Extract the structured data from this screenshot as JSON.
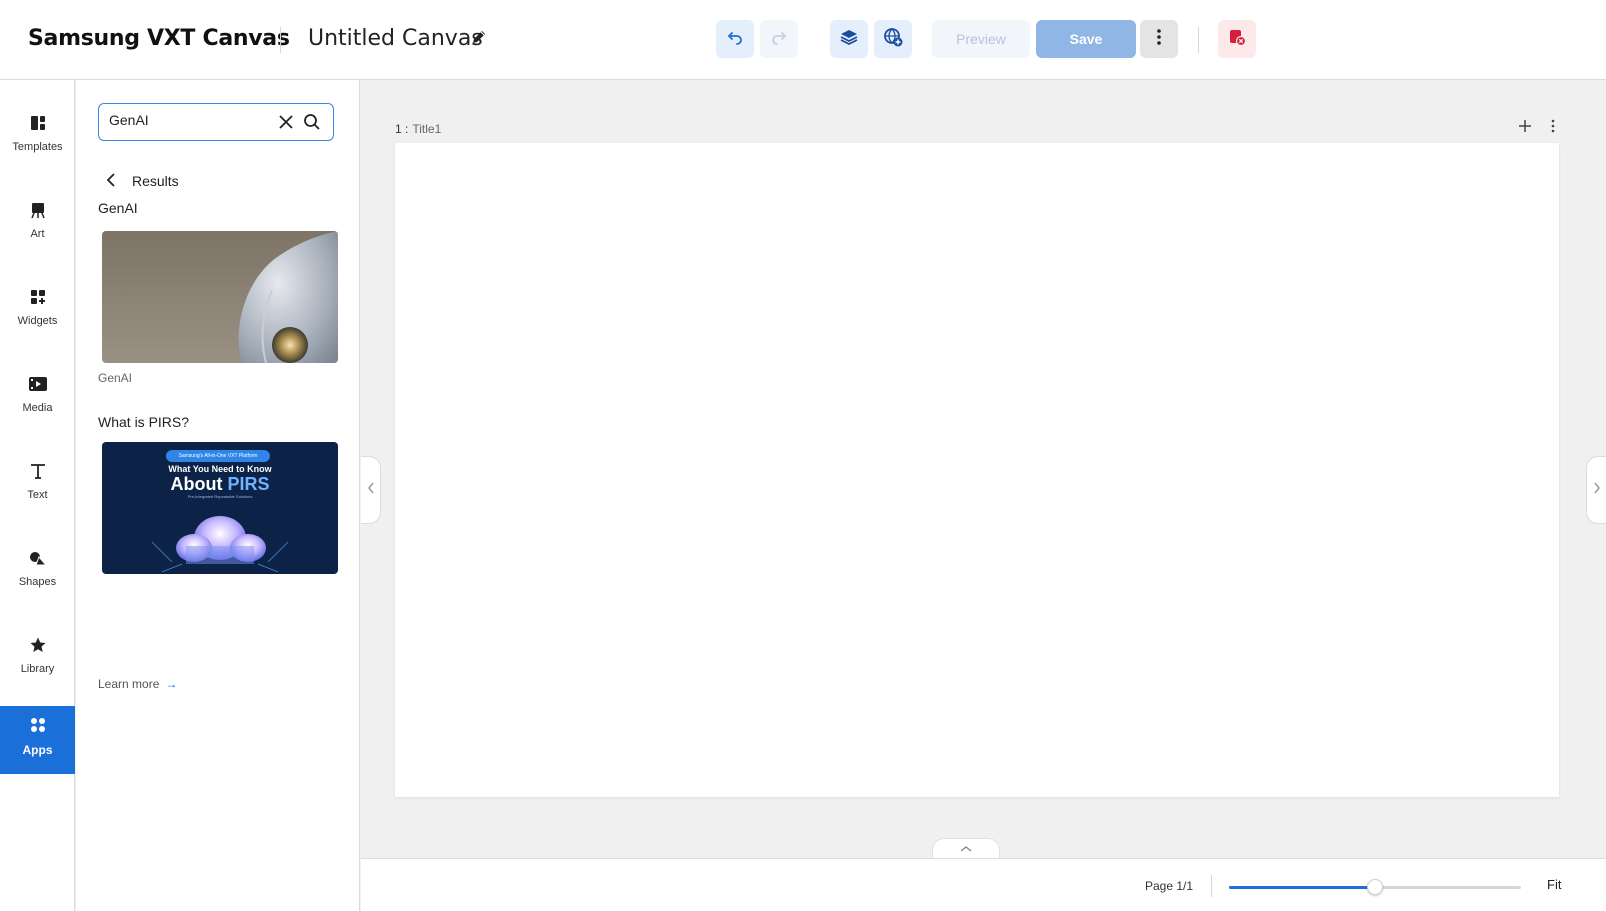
{
  "app": {
    "brand": "Samsung VXT Canvas",
    "canvas_title": "Untitled Canvas"
  },
  "toolbar": {
    "preview_label": "Preview",
    "save_label": "Save",
    "icons": [
      "undo-icon",
      "redo-icon",
      "layers-icon",
      "globe-add-icon",
      "more-vertical-icon",
      "exit-icon"
    ]
  },
  "sidebar": {
    "items": [
      {
        "label": "Templates",
        "icon": "templates-icon"
      },
      {
        "label": "Art",
        "icon": "art-icon"
      },
      {
        "label": "Widgets",
        "icon": "widgets-icon"
      },
      {
        "label": "Media",
        "icon": "media-icon"
      },
      {
        "label": "Text",
        "icon": "text-icon"
      },
      {
        "label": "Shapes",
        "icon": "shapes-icon"
      },
      {
        "label": "Library",
        "icon": "library-icon"
      },
      {
        "label": "Apps",
        "icon": "apps-icon",
        "active": true
      }
    ]
  },
  "panel": {
    "search_value": "GenAI",
    "results_label": "Results",
    "section1_title": "GenAI",
    "section1_caption": "GenAI",
    "section2_title": "What is PIRS?",
    "promo": {
      "pill": "Samsung's All-in-One VXT Platform",
      "headline": "What You Need to Know",
      "headline_big": "About ",
      "headline_accent": "PIRS",
      "sub": "Pre-Integrated Repeatable Solutions"
    },
    "learn_more": "Learn more",
    "learn_more_arrow": "→"
  },
  "canvas": {
    "page_number": "1 :",
    "page_title": "Title1"
  },
  "footer": {
    "page_count": "Page 1/1",
    "zoom_fit": "Fit",
    "zoom_level": 0.5
  },
  "colors": {
    "accent": "#1a6fd9",
    "save_bg": "#90b6e6"
  }
}
